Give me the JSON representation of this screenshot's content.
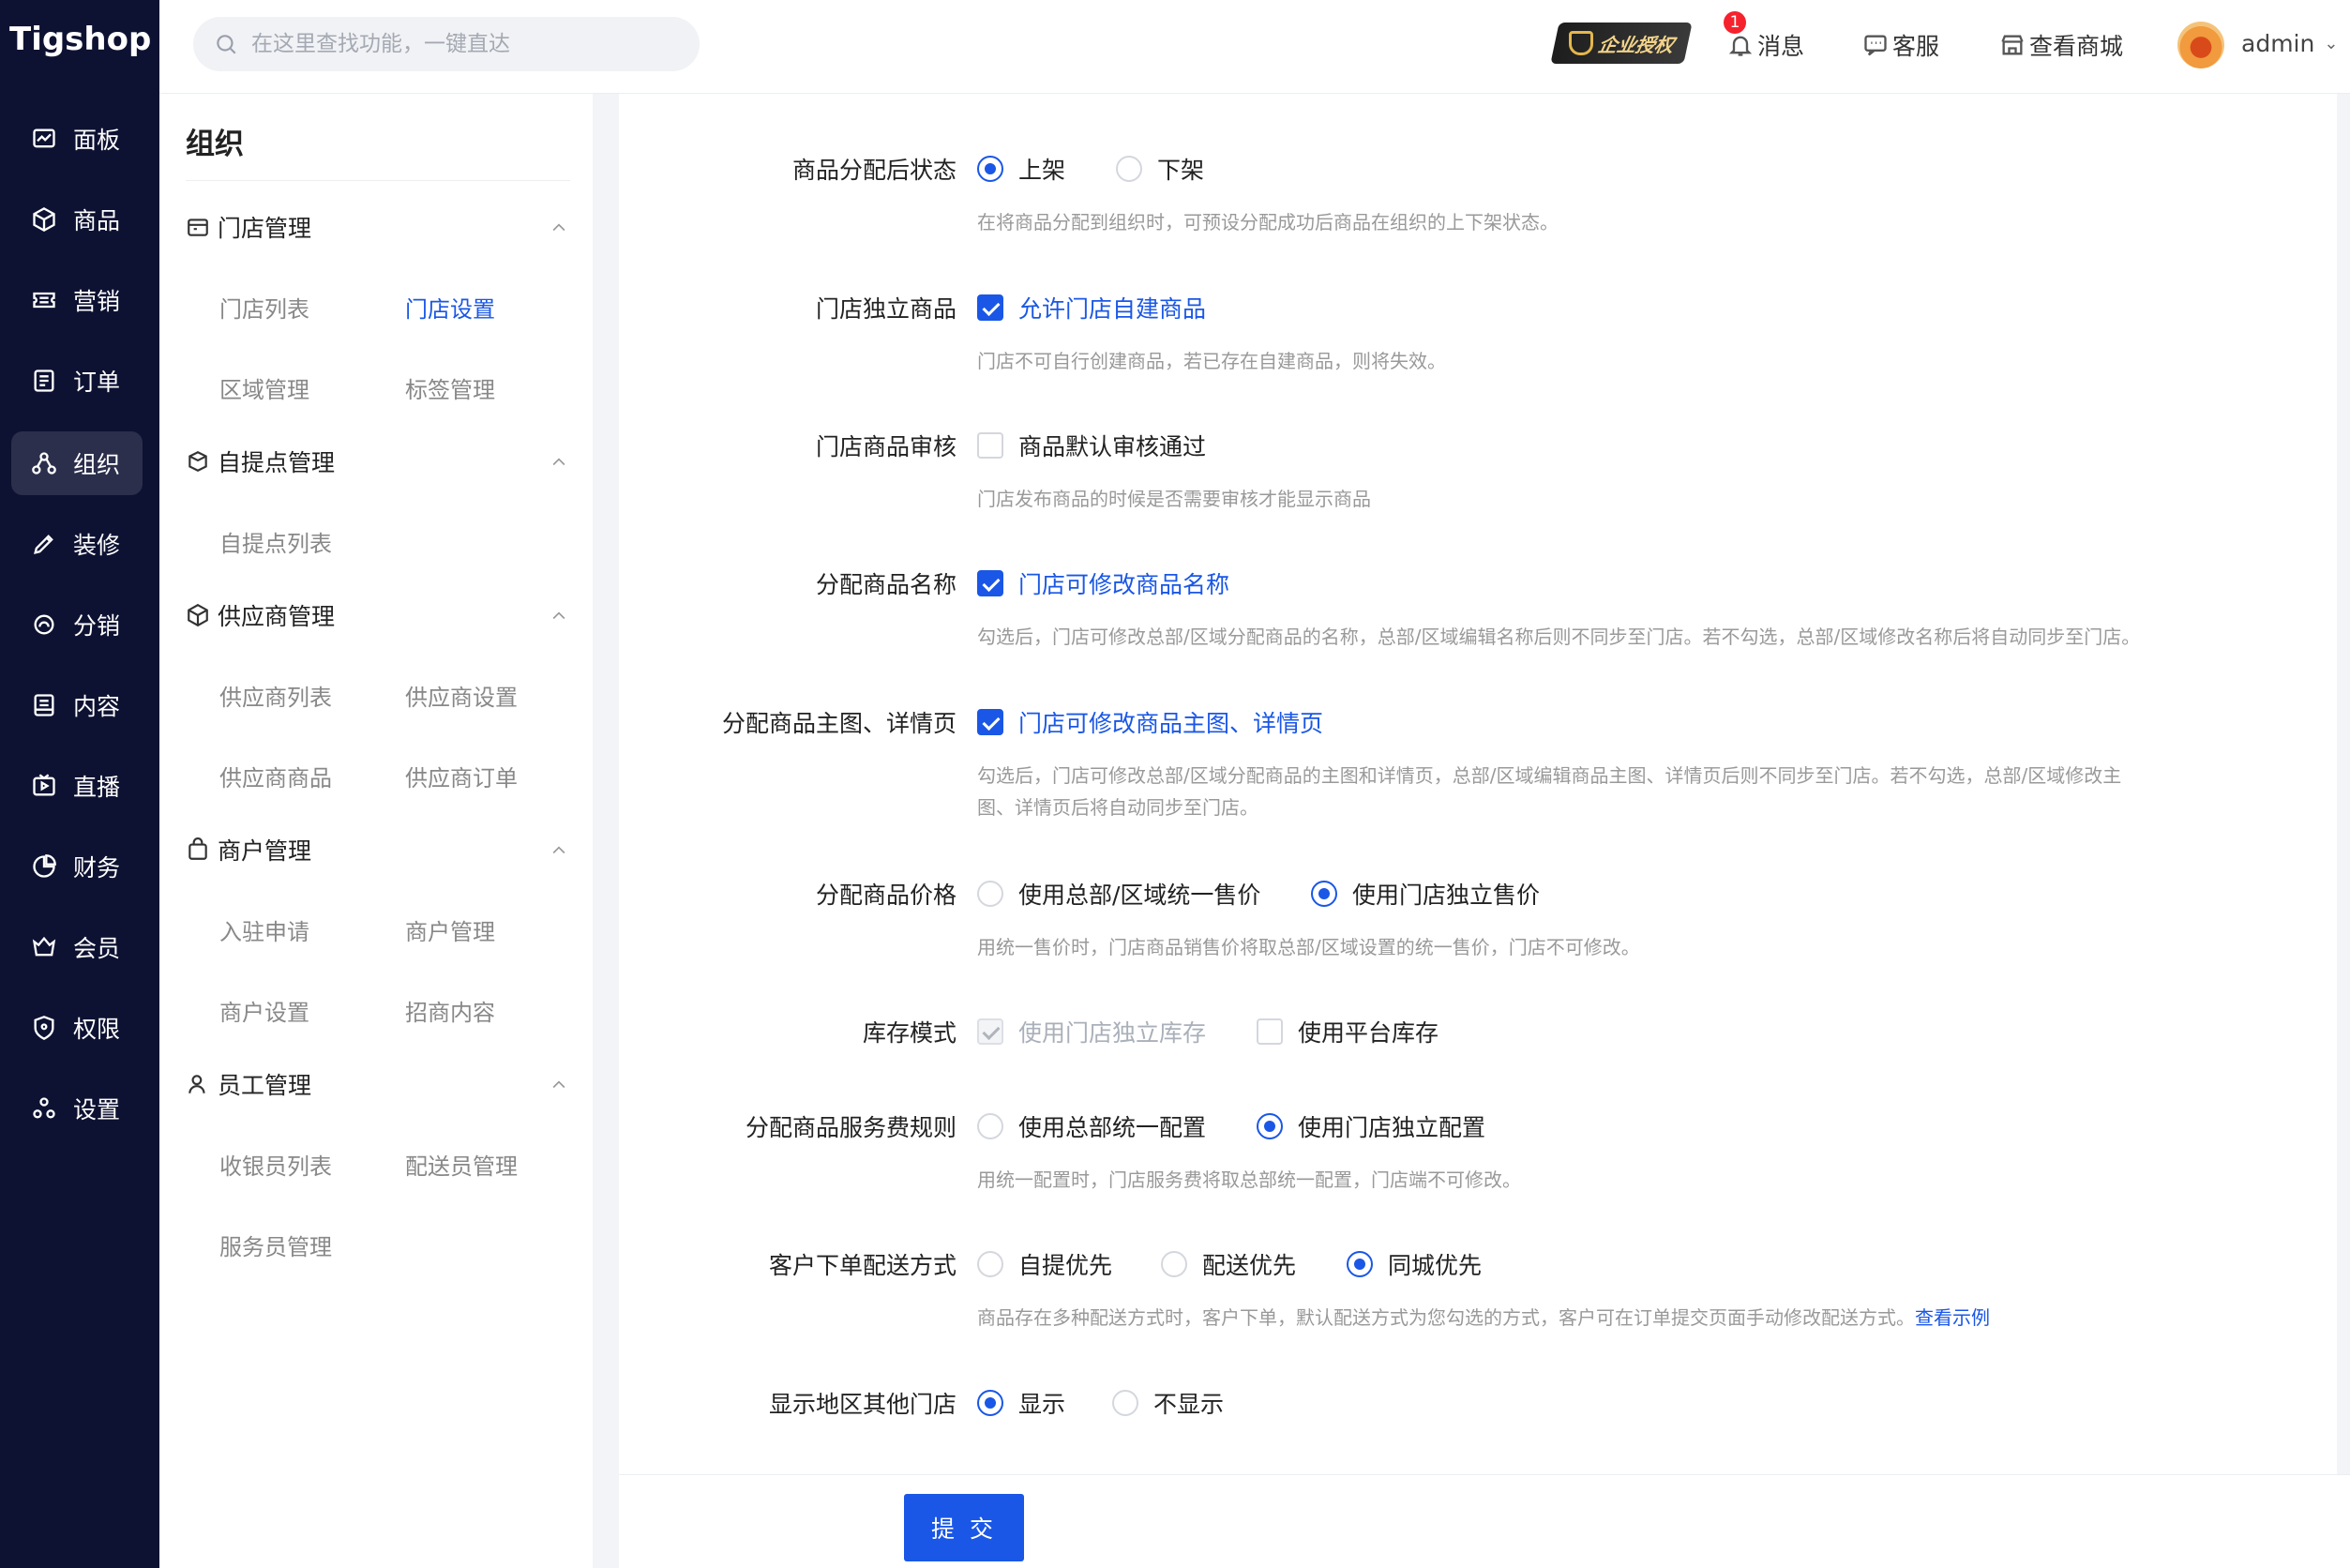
{
  "logo": "Tigshop",
  "nav": [
    {
      "label": "面板",
      "icon": "dashboard-icon"
    },
    {
      "label": "商品",
      "icon": "box-icon"
    },
    {
      "label": "营销",
      "icon": "ticket-icon"
    },
    {
      "label": "订单",
      "icon": "order-icon"
    },
    {
      "label": "组织",
      "icon": "org-icon",
      "active": true
    },
    {
      "label": "装修",
      "icon": "brush-icon"
    },
    {
      "label": "分销",
      "icon": "share-icon"
    },
    {
      "label": "内容",
      "icon": "content-icon"
    },
    {
      "label": "直播",
      "icon": "live-icon"
    },
    {
      "label": "财务",
      "icon": "pie-icon"
    },
    {
      "label": "会员",
      "icon": "member-icon"
    },
    {
      "label": "权限",
      "icon": "shield-icon"
    },
    {
      "label": "设置",
      "icon": "settings-icon"
    }
  ],
  "header": {
    "search_placeholder": "在这里查找功能，一键直达",
    "auth_badge": "企业授权",
    "message_label": "消息",
    "message_count": "1",
    "service_label": "客服",
    "mall_label": "查看商城",
    "username": "admin"
  },
  "subside": {
    "title": "组织",
    "groups": [
      {
        "label": "门店管理",
        "items": [
          "门店列表",
          "门店设置",
          "区域管理",
          "标签管理"
        ]
      },
      {
        "label": "自提点管理",
        "items": [
          "自提点列表"
        ]
      },
      {
        "label": "供应商管理",
        "items": [
          "供应商列表",
          "供应商设置",
          "供应商商品",
          "供应商订单"
        ]
      },
      {
        "label": "商户管理",
        "items": [
          "入驻申请",
          "商户管理",
          "商户设置",
          "招商内容"
        ]
      },
      {
        "label": "员工管理",
        "items": [
          "收银员列表",
          "配送员管理",
          "服务员管理"
        ]
      }
    ],
    "active_item": "门店设置"
  },
  "form": {
    "status_after_assign": {
      "label": "商品分配后状态",
      "options": [
        "上架",
        "下架"
      ],
      "selected": "上架",
      "hint": "在将商品分配到组织时，可预设分配成功后商品在组织的上下架状态。"
    },
    "independent_goods": {
      "label": "门店独立商品",
      "option": "允许门店自建商品",
      "checked": true,
      "hint": "门店不可自行创建商品，若已存在自建商品，则将失效。"
    },
    "goods_review": {
      "label": "门店商品审核",
      "option": "商品默认审核通过",
      "checked": false,
      "hint": "门店发布商品的时候是否需要审核才能显示商品"
    },
    "assign_name": {
      "label": "分配商品名称",
      "option": "门店可修改商品名称",
      "checked": true,
      "hint": "勾选后，门店可修改总部/区域分配商品的名称，总部/区域编辑名称后则不同步至门店。若不勾选，总部/区域修改名称后将自动同步至门店。"
    },
    "assign_images": {
      "label": "分配商品主图、详情页",
      "option": "门店可修改商品主图、详情页",
      "checked": true,
      "hint_line1": "勾选后，门店可修改总部/区域分配商品的主图和详情页，总部/区域编辑商品主图、详情页后则不同步至门店。若不勾选，总部/区域修改主",
      "hint_line2": "图、详情页后将自动同步至门店。"
    },
    "assign_price": {
      "label": "分配商品价格",
      "options": [
        "使用总部/区域统一售价",
        "使用门店独立售价"
      ],
      "selected": "使用门店独立售价",
      "hint": "用统一售价时，门店商品销售价将取总部/区域设置的统一售价，门店不可修改。"
    },
    "stock_mode": {
      "label": "库存模式",
      "options": [
        "使用门店独立库存",
        "使用平台库存"
      ]
    },
    "service_fee": {
      "label": "分配商品服务费规则",
      "options": [
        "使用总部统一配置",
        "使用门店独立配置"
      ],
      "selected": "使用门店独立配置",
      "hint": "用统一配置时，门店服务费将取总部统一配置，门店端不可修改。"
    },
    "delivery": {
      "label": "客户下单配送方式",
      "options": [
        "自提优先",
        "配送优先",
        "同城优先"
      ],
      "selected": "同城优先",
      "hint": "商品存在多种配送方式时，客户下单，默认配送方式为您勾选的方式，客户可在订单提交页面手动修改配送方式。",
      "hint_link": "查看示例"
    },
    "show_other_stores": {
      "label": "显示地区其他门店",
      "options": [
        "显示",
        "不显示"
      ],
      "selected": "显示"
    }
  },
  "submit_label": "提 交",
  "colors": {
    "primary": "#1a57e6",
    "nav_bg": "#0e1232"
  }
}
